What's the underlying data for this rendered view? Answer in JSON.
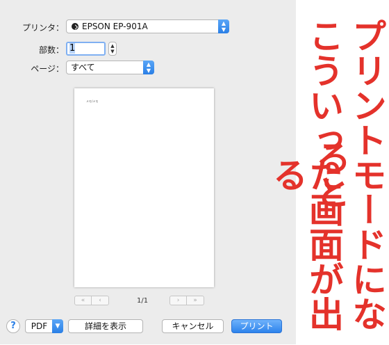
{
  "dialog": {
    "printer_label": "プリンタ：",
    "printer_value": "EPSON EP-901A",
    "copies_label": "部数：",
    "copies_value": "1",
    "pages_label": "ページ：",
    "pages_value": "すべて",
    "preview_text": "メモ/メモ",
    "page_indicator": "1/1",
    "nav_first": "«",
    "nav_prev": "‹",
    "nav_next": "›",
    "nav_last": "»"
  },
  "footer": {
    "help_label": "?",
    "pdf_label": "PDF",
    "details_label": "詳細を表示",
    "cancel_label": "キャンセル",
    "print_label": "プリント"
  },
  "caption": {
    "line1": "こういった画面が出る",
    "line2": "プリントモードになると"
  },
  "colors": {
    "accent_blue": "#2a7fe6",
    "caption_red": "#e4322b",
    "dialog_bg": "#ececec"
  },
  "icons": [
    "printer-status-icon",
    "popup-arrows-icon",
    "stepper-icon",
    "chevron-down-icon",
    "help-icon"
  ]
}
